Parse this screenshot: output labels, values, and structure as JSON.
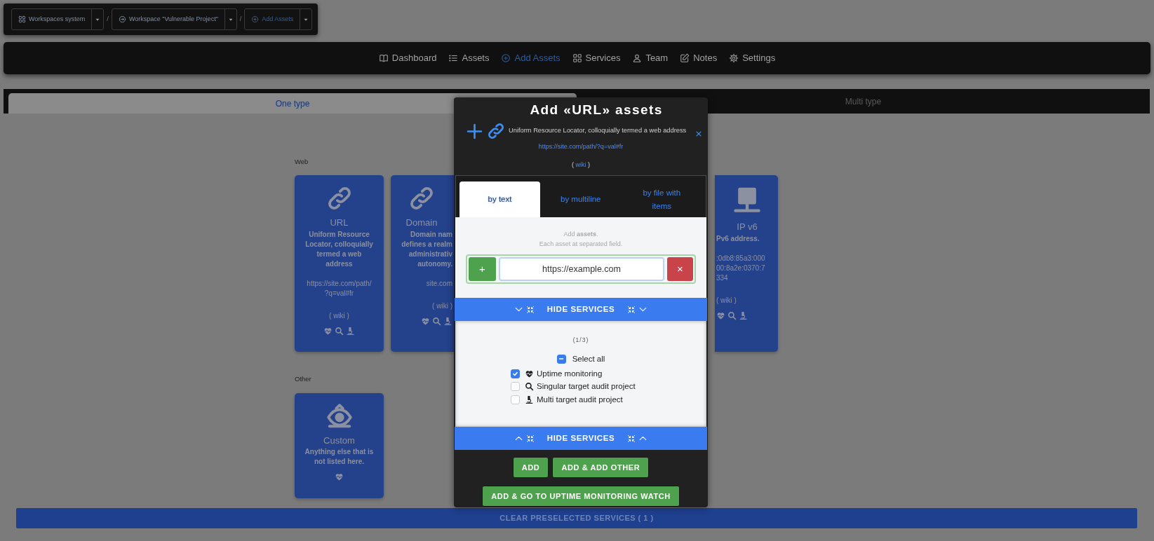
{
  "breadcrumb": [
    {
      "kind": "workspaces",
      "label": "Workspaces system",
      "selected": false
    },
    {
      "kind": "workspace",
      "label": "Workspace \"Vulnerable Project\"",
      "selected": false
    },
    {
      "kind": "add",
      "label": "Add Assets",
      "selected": true
    }
  ],
  "breadcrumb_separators": [
    "/",
    "/"
  ],
  "nav": [
    {
      "kind": "dashboard",
      "label": "Dashboard",
      "selected": false
    },
    {
      "kind": "assets",
      "label": "Assets",
      "selected": false
    },
    {
      "kind": "add",
      "label": "Add Assets",
      "selected": true
    },
    {
      "kind": "services",
      "label": "Services",
      "selected": false
    },
    {
      "kind": "team",
      "label": "Team",
      "selected": false
    },
    {
      "kind": "notes",
      "label": "Notes",
      "selected": false
    },
    {
      "kind": "settings",
      "label": "Settings",
      "selected": false
    }
  ],
  "page_tabs": [
    {
      "label": "One type",
      "selected": true
    },
    {
      "label": "Multi type",
      "selected": false
    }
  ],
  "groups": [
    {
      "label": "Web",
      "cards": [
        {
          "kind": "url",
          "title": "URL",
          "description_lines": [
            "Uniform Resource",
            "Locator, colloquially",
            "termed a web",
            "address"
          ],
          "example_lines": [
            "https://site.com/path/",
            "?q=val#fr"
          ],
          "wiki": "( wiki )",
          "services": [
            {
              "kind": "uptime"
            },
            {
              "kind": "singular"
            },
            {
              "kind": "multi"
            }
          ]
        },
        {
          "kind": "domain",
          "cut_right": true,
          "title": "Domain",
          "description_lines": [
            "Domain nam",
            "defines a realm",
            "administrativ",
            "autonomy."
          ],
          "example_lines": [
            "site.com"
          ],
          "wiki": "( wiki )",
          "services": [
            {
              "kind": "uptime"
            },
            {
              "kind": "singular"
            },
            {
              "kind": "multi"
            }
          ]
        },
        {
          "kind": "ip",
          "cut_left": true,
          "title": "IP v6",
          "description_lines": [
            "Pv6 address."
          ],
          "example_lines": [
            ":0db8:85a3:000",
            "00:8a2e:0370:7",
            "334"
          ],
          "wiki": "( wiki )",
          "services": [
            {
              "kind": "uptime"
            },
            {
              "kind": "singular"
            },
            {
              "kind": "multi"
            }
          ]
        }
      ]
    },
    {
      "label": "Other",
      "cards": [
        {
          "kind": "custom",
          "title": "Custom",
          "description_lines": [
            "Anything else that is",
            "not listed here."
          ],
          "services": [
            {
              "kind": "uptime"
            }
          ]
        }
      ]
    }
  ],
  "clear_button": "CLEAR PRESELECTED SERVICES ( 1 )",
  "modal": {
    "title": "Add «URL» assets",
    "description": "Uniform Resource Locator, colloquially termed a web address",
    "example": "https://site.com/path/?q=val#fr",
    "wiki_before": "(",
    "wiki": "wiki",
    "wiki_after": ")",
    "tabs": [
      {
        "label": "by text",
        "selected": true
      },
      {
        "label": "by multiline",
        "selected": false
      },
      {
        "label": "by file with items",
        "selected": false
      }
    ],
    "hint": "Add **assets**.",
    "hint_2": "Each asset at separated field.",
    "add_field_button": "+",
    "entries": [
      {
        "value": "https://example.com"
      }
    ],
    "remove_button": "×",
    "hide_services_top": "HIDE SERVICES",
    "services_count": "(1/3)",
    "select_all": {
      "label": "Select all",
      "indeterminate": true
    },
    "services": [
      {
        "kind": "uptime",
        "label": "Uptime monitoring",
        "checked": true
      },
      {
        "kind": "singular",
        "label": "Singular target audit project",
        "checked": false
      },
      {
        "kind": "multi",
        "label": "Multi target audit project",
        "checked": false
      }
    ],
    "hide_services_bottom": "HIDE SERVICES",
    "buttons": [
      "ADD",
      "ADD & ADD OTHER",
      "ADD & GO TO UPTIME MONITORING WATCH"
    ]
  }
}
